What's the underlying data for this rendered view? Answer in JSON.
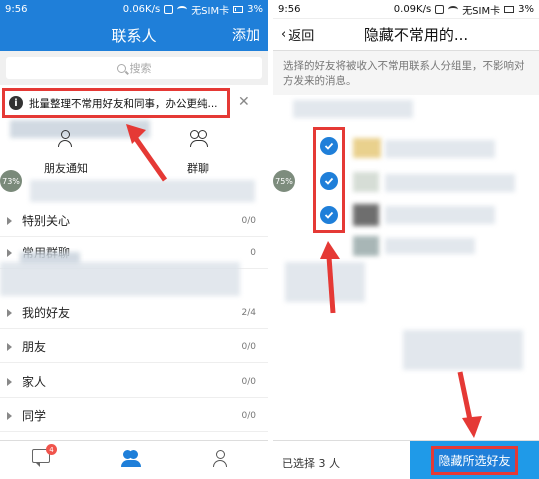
{
  "left_screen": {
    "status": {
      "time": "9:56",
      "speed": "0.06K/s",
      "carrier": "无SIM卡",
      "battery": "3%"
    },
    "header": {
      "title": "联系人",
      "add_label": "添加"
    },
    "search": {
      "placeholder": "搜索"
    },
    "notice": {
      "text": "批量整理不常用好友和同事，办公更纯..."
    },
    "quick": {
      "friend_notify": "朋友通知",
      "group_chat": "群聊"
    },
    "percent_badge": "73%",
    "groups": [
      {
        "name": "特别关心",
        "count": "0/0"
      },
      {
        "name": "常用群聊",
        "count": "0"
      },
      {
        "name": "我的好友",
        "count": "2/4"
      },
      {
        "name": "朋友",
        "count": "0/0"
      },
      {
        "name": "家人",
        "count": "0/0"
      },
      {
        "name": "同学",
        "count": "0/0"
      }
    ],
    "nav": {
      "message_badge": "4"
    }
  },
  "right_screen": {
    "status": {
      "time": "9:56",
      "speed": "0.09K/s",
      "carrier": "无SIM卡",
      "battery": "3%"
    },
    "header": {
      "back_label": "返回",
      "title": "隐藏不常用的..."
    },
    "description": "选择的好友将被收入不常用联系人分组里，不影响对方发来的消息。",
    "percent_badge": "75%",
    "selected_count_text": "已选择 3 人",
    "hide_button_label": "隐藏所选好友"
  },
  "colors": {
    "accent": "#1f7fd9",
    "annotation": "#e53935",
    "button": "#1f9ae8"
  }
}
